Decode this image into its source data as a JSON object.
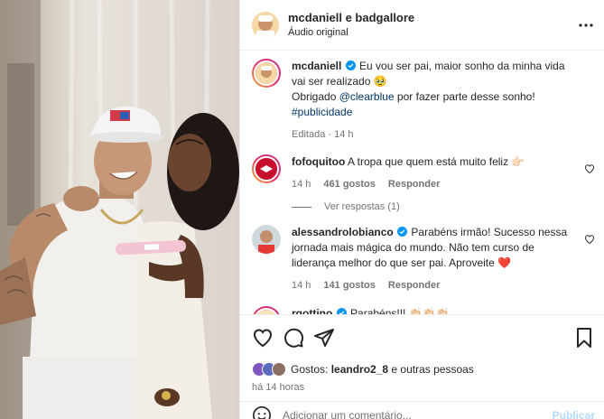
{
  "header": {
    "username": "mcdaniell e badgallore",
    "audio": "Áudio original"
  },
  "caption": {
    "username": "mcdaniell",
    "line1": "Eu vou ser pai, maior sonho da minha vida vai ser realizado 🥹",
    "line2_prefix": "Obrigado ",
    "mention": "@clearblue",
    "line2_suffix": " por fazer parte desse sonho!",
    "hashtag": "#publicidade",
    "meta": "Editada · 14 h"
  },
  "comments": [
    {
      "username": "fofoquitoo",
      "text": "A tropa que quem está muito feliz 👉🏻",
      "time": "14 h",
      "likes": "461 gostos",
      "reply": "Responder",
      "view_replies": "Ver respostas (1)"
    },
    {
      "username": "alessandrolobianco",
      "text": "Parabéns irmão! Sucesso nessa jornada mais mágica do mundo. Não tem curso de liderança melhor do que ser pai. Aproveite ❤️",
      "time": "14 h",
      "likes": "141 gostos",
      "reply": "Responder"
    },
    {
      "username": "rgottino",
      "text": "Parabéns!!! 👏🏻👏🏻👏🏻"
    }
  ],
  "likes": {
    "prefix": "Gostos: ",
    "user": "leandro2_8",
    "suffix": " e outras pessoas"
  },
  "post_time": "há 14 horas",
  "add_comment": {
    "placeholder": "Adicionar um comentário...",
    "post_label": "Publicar"
  },
  "icons": {
    "more": "more-dots-icon",
    "like": "heart-icon",
    "comment": "comment-bubble-icon",
    "share": "paper-plane-icon",
    "save": "bookmark-icon",
    "emoji": "emoji-smile-icon",
    "verified": "verified-badge-icon"
  },
  "colors": {
    "link": "#00376b",
    "verified": "#0095f6",
    "secondary_text": "#737373",
    "post_button": "#b3dbff",
    "heart_emoji": "#ed4956"
  }
}
